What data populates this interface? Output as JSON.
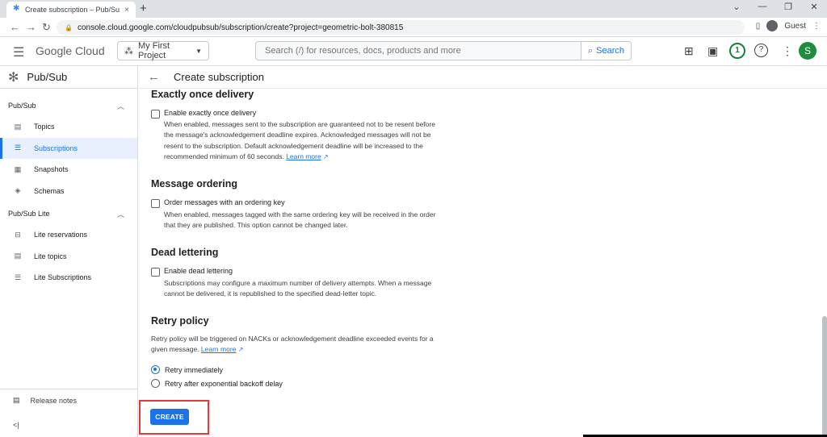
{
  "browser": {
    "tab_title": "Create subscription – Pub/Sub –",
    "tab_close": "×",
    "new_tab": "+",
    "url": "console.cloud.google.com/cloudpubsub/subscription/create?project=geometric-bolt-380815",
    "guest_label": "Guest",
    "window_controls": [
      "⌄",
      "—",
      "❐",
      "✕"
    ]
  },
  "header": {
    "logo_google": "Google",
    "logo_cloud": "Cloud",
    "project_name": "My First Project",
    "search_placeholder": "Search (/) for resources, docs, products and more",
    "search_button": "Search",
    "notification_count": "1",
    "user_initial": "S"
  },
  "sidebar": {
    "product_title": "Pub/Sub",
    "sections": [
      {
        "title": "Pub/Sub",
        "items": [
          {
            "label": "Topics",
            "icon": "topic-icon"
          },
          {
            "label": "Subscriptions",
            "icon": "list-icon",
            "active": true
          },
          {
            "label": "Snapshots",
            "icon": "snapshot-icon"
          },
          {
            "label": "Schemas",
            "icon": "schema-icon"
          }
        ]
      },
      {
        "title": "Pub/Sub Lite",
        "items": [
          {
            "label": "Lite reservations",
            "icon": "reservation-icon"
          },
          {
            "label": "Lite topics",
            "icon": "topic-icon"
          },
          {
            "label": "Lite Subscriptions",
            "icon": "list-icon"
          }
        ]
      }
    ],
    "release_notes": "Release notes",
    "collapse": "<|"
  },
  "main": {
    "page_title": "Create subscription",
    "exactly_once": {
      "title": "Exactly once delivery",
      "checkbox_label": "Enable exactly once delivery",
      "description": "When enabled, messages sent to the subscription are guaranteed not to be resent before the message's acknowledgement deadline expires. Acknowledged messages will not be resent to the subscription. Default acknowledgement deadline will be increased to the recommended minimum of 60 seconds.",
      "learn_more": "Learn more"
    },
    "message_ordering": {
      "title": "Message ordering",
      "checkbox_label": "Order messages with an ordering key",
      "description": "When enabled, messages tagged with the same ordering key will be received in the order that they are published. This option cannot be changed later."
    },
    "dead_lettering": {
      "title": "Dead lettering",
      "checkbox_label": "Enable dead lettering",
      "description": "Subscriptions may configure a maximum number of delivery attempts. When a message cannot be delivered, it is republished to the specified dead-letter topic."
    },
    "retry_policy": {
      "title": "Retry policy",
      "description": "Retry policy will be triggered on NACKs or acknowledgement deadline exceeded events for a given message.",
      "learn_more": "Learn more",
      "options": [
        {
          "label": "Retry immediately",
          "selected": true
        },
        {
          "label": "Retry after exponential backoff delay",
          "selected": false
        }
      ]
    },
    "create_button": "CREATE"
  },
  "colors": {
    "accent": "#1a73e8",
    "highlight": "#e53935",
    "avatar": "#1e8e3e"
  }
}
